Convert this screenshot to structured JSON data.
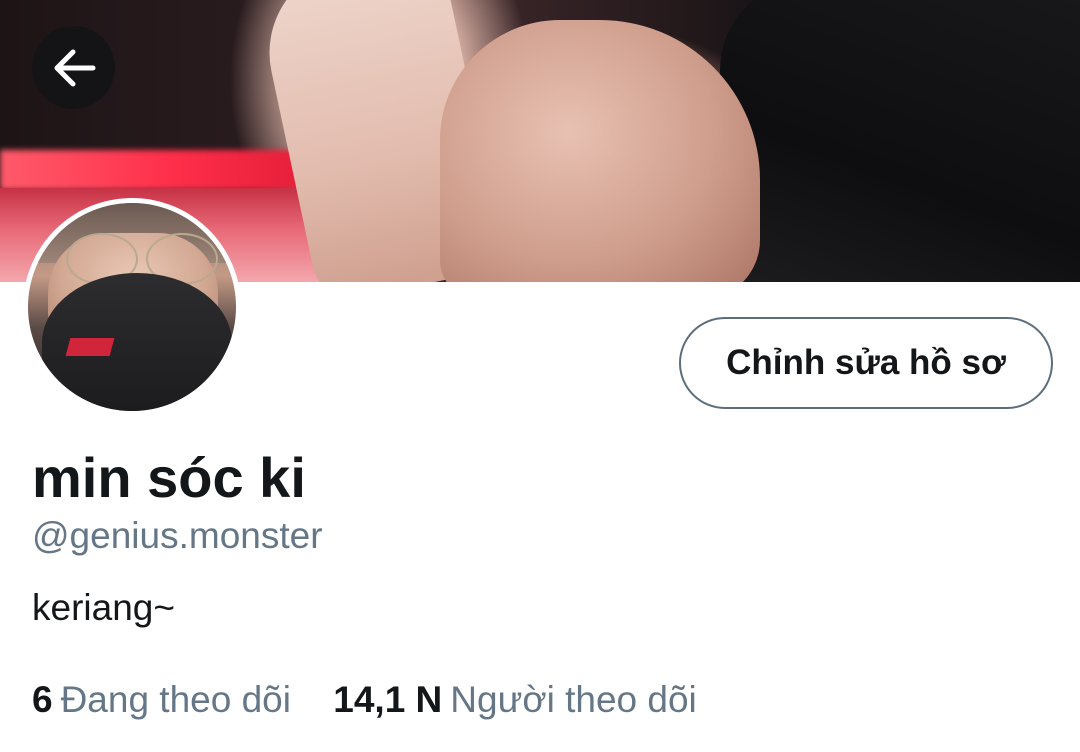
{
  "header": {
    "back_icon": "arrow-left-icon"
  },
  "profile": {
    "display_name": "min sóc ki",
    "handle": "@genius.monster",
    "bio": "keriang~",
    "edit_button_label": "Chỉnh sửa hồ sơ"
  },
  "stats": {
    "following_count": "6",
    "following_label": "Đang theo dõi",
    "followers_count": "14,1 N",
    "followers_label": "Người theo dõi"
  },
  "colors": {
    "text_primary": "#14171a",
    "text_secondary": "#657786",
    "button_border": "#5c6e7c"
  }
}
